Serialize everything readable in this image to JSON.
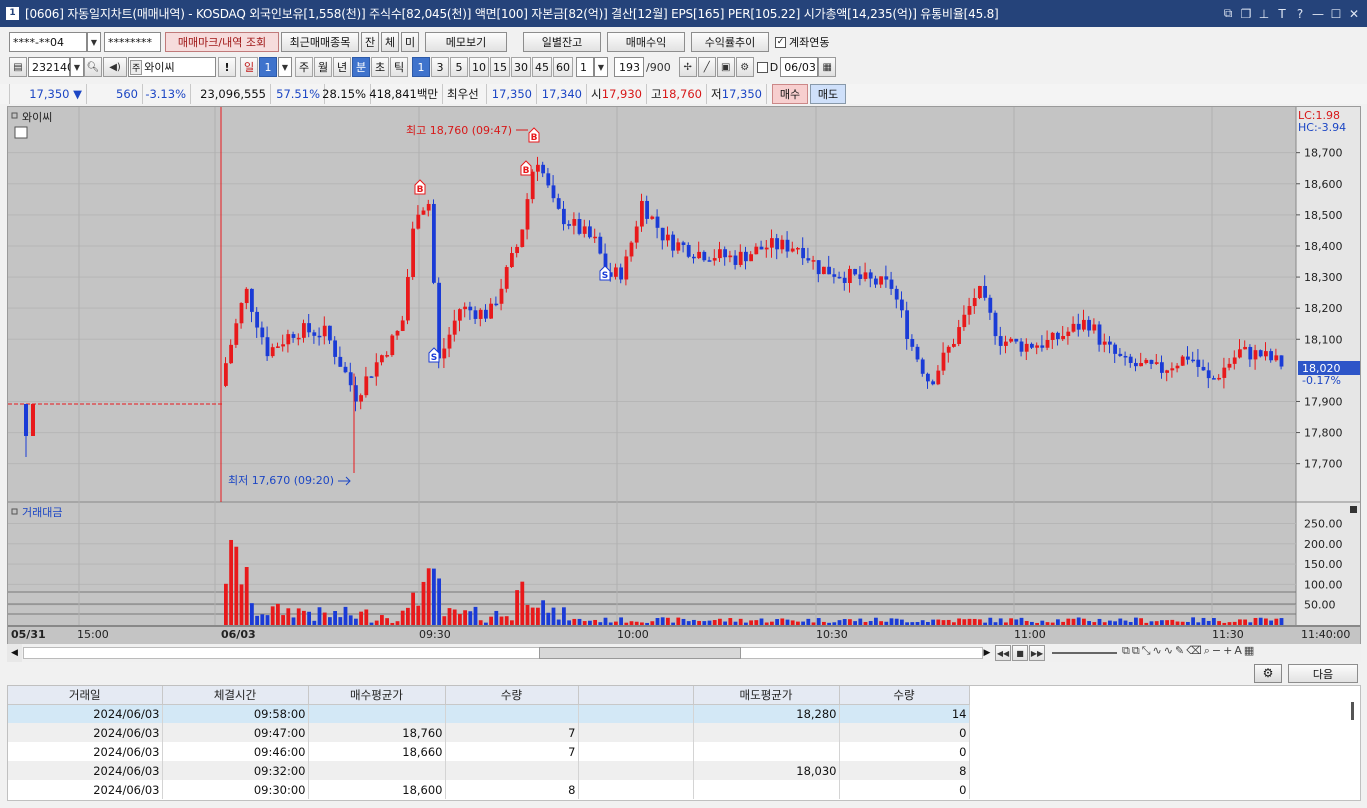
{
  "window": {
    "number": "1",
    "title": "[0606] 자동일지차트(매매내역) - KOSDAQ 외국인보유[1,558(천)] 주식수[82,045(천)] 액면[100] 자본금[82(억)] 결산[12월] EPS[165] PER[105.22] 시가총액[14,235(억)] 유통비율[45.8]"
  },
  "toolbar1": {
    "account": "****-**04",
    "password": "********",
    "btn_mark": "매매마크/내역 조회",
    "btn_recent": "최근매매종목",
    "btn_jan": "잔",
    "btn_che": "체",
    "btn_mi": "미",
    "btn_memo": "메모보기",
    "btn_daily": "일별잔고",
    "btn_profit": "매매수익",
    "btn_rate": "수익률추이",
    "chk_account": "계좌연동"
  },
  "toolbar2": {
    "code": "232140",
    "name": "와이씨",
    "excl": "!",
    "day": "일",
    "day_n": "1",
    "week": "주",
    "month": "월",
    "year": "년",
    "minute": "분",
    "sec": "초",
    "tick": "틱",
    "intervals": [
      "1",
      "3",
      "5",
      "10",
      "15",
      "30",
      "45",
      "60"
    ],
    "interval_sel": "1",
    "count": "193",
    "count_total": "/900",
    "d_label": "D",
    "date": "06/03"
  },
  "quote": {
    "price": "17,350",
    "arrow": "▼",
    "change": "560",
    "rate": "-3.13%",
    "volume": "23,096,555",
    "r1": "57.51%",
    "r2": "28.15%",
    "amount": "418,841백만",
    "best_label": "최우선",
    "best_ask": "17,350",
    "best_bid": "17,340",
    "open_label": "시",
    "open": "17,930",
    "high_label": "고",
    "high": "18,760",
    "low_label": "저",
    "low": "17,350",
    "buy": "매수",
    "sell": "매도"
  },
  "chart": {
    "panel1": "와이씨",
    "panel2": "거래대금",
    "lc": "LC:1.98",
    "hc": "HC:-3.94",
    "cur_price": "18,020",
    "cur_rate": "-0.17%",
    "max_label": "최고 18,760 (09:47)",
    "min_label": "최저 17,670 (09:20)",
    "price_ticks": [
      "18,700",
      "18,600",
      "18,500",
      "18,400",
      "18,300",
      "18,200",
      "18,100",
      "17,900",
      "17,800",
      "17,700"
    ],
    "vol_ticks": [
      "250.00",
      "200.00",
      "150.00",
      "100.00",
      "50.00"
    ],
    "time_labels": [
      "05/31",
      "15:00",
      "06/03",
      "09:30",
      "10:00",
      "10:30",
      "11:00",
      "11:30"
    ],
    "end_time": "11:40:00"
  },
  "colors": {
    "up": "#e8191b",
    "down": "#1a3bd6",
    "chart_bg": "#c4c4c4"
  },
  "bottom": {
    "next": "다음"
  },
  "table": {
    "headers": [
      "거래일",
      "체결시간",
      "매수평균가",
      "수량",
      "",
      "매도평균가",
      "수량"
    ],
    "rows": [
      [
        "2024/06/03",
        "09:58:00",
        "",
        "",
        "",
        "18,280",
        "14"
      ],
      [
        "2024/06/03",
        "09:47:00",
        "18,760",
        "7",
        "",
        "",
        "0"
      ],
      [
        "2024/06/03",
        "09:46:00",
        "18,660",
        "7",
        "",
        "",
        "0"
      ],
      [
        "2024/06/03",
        "09:32:00",
        "",
        "",
        "",
        "18,030",
        "8"
      ],
      [
        "2024/06/03",
        "09:30:00",
        "18,600",
        "8",
        "",
        "",
        "0"
      ]
    ]
  }
}
